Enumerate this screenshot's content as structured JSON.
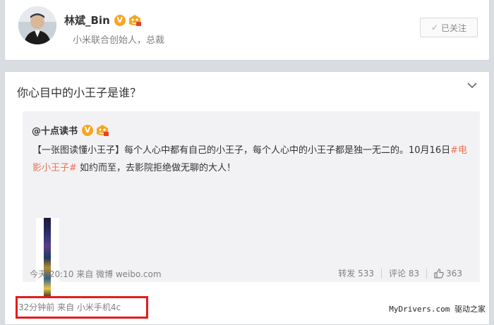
{
  "profile": {
    "name": "林斌_Bin",
    "verified_badge": "V",
    "title": "小米联合创始人，总裁",
    "follow_button_label": "已关注"
  },
  "post": {
    "text": "你心目中的小王子是谁？",
    "repost": {
      "author": "@十点读书",
      "verified_badge": "V",
      "body_part1": "【一张图读懂小王子】每个人心中都有自己的小王子，每个人心中的小王子都是独一无二的。10月16日",
      "hashtag": "#电影小王子#",
      "body_part2": " 如约而至，去影院拒绝做无聊的大人！",
      "time_source": "今天 20:10 来自 微博 weibo.com",
      "repost_label": "转发 533",
      "comment_label": "评论 83",
      "like_count": "363"
    },
    "source_line": "32分钟前 来自 小米手机4c"
  },
  "watermark": "MyDrivers.com 驱动之家",
  "icons": {
    "verified": "verified-v-icon",
    "vip": "vip-member-icon",
    "follow_check": "check-icon",
    "collapse": "chevron-down-icon",
    "like": "thumbs-up-icon"
  },
  "colors": {
    "hashtag": "#eb7350",
    "verified": "#f6a623",
    "highlight_box": "#e21d1d"
  }
}
